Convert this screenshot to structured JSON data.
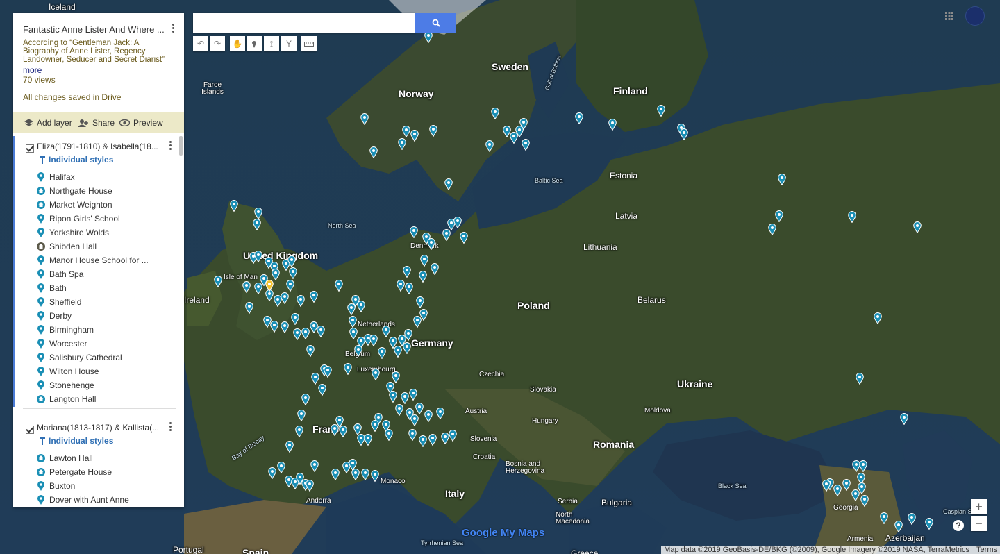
{
  "map": {
    "countries": [
      {
        "id": "iceland",
        "text": "Iceland"
      },
      {
        "id": "sweden",
        "text": "Sweden"
      },
      {
        "id": "finland",
        "text": "Finland"
      },
      {
        "id": "norway",
        "text": "Norway"
      },
      {
        "id": "estonia",
        "text": "Estonia"
      },
      {
        "id": "latvia",
        "text": "Latvia"
      },
      {
        "id": "lithuania",
        "text": "Lithuania"
      },
      {
        "id": "united-kingdom",
        "text": "United Kingdom"
      },
      {
        "id": "ireland",
        "text": "Ireland"
      },
      {
        "id": "denmark",
        "text": "Denmark"
      },
      {
        "id": "netherlands",
        "text": "Netherlands"
      },
      {
        "id": "belgium",
        "text": "Belgium"
      },
      {
        "id": "luxembourg",
        "text": "Luxembourg"
      },
      {
        "id": "germany",
        "text": "Germany"
      },
      {
        "id": "poland",
        "text": "Poland"
      },
      {
        "id": "belarus",
        "text": "Belarus"
      },
      {
        "id": "ukraine",
        "text": "Ukraine"
      },
      {
        "id": "czechia",
        "text": "Czechia"
      },
      {
        "id": "slovakia",
        "text": "Slovakia"
      },
      {
        "id": "austria",
        "text": "Austria"
      },
      {
        "id": "hungary",
        "text": "Hungary"
      },
      {
        "id": "moldova",
        "text": "Moldova"
      },
      {
        "id": "france",
        "text": "France"
      },
      {
        "id": "slovenia",
        "text": "Slovenia"
      },
      {
        "id": "croatia",
        "text": "Croatia"
      },
      {
        "id": "bosnia",
        "text": "Bosnia and Herzegovina"
      },
      {
        "id": "serbia",
        "text": "Serbia"
      },
      {
        "id": "romania",
        "text": "Romania"
      },
      {
        "id": "bulgaria",
        "text": "Bulgaria"
      },
      {
        "id": "north-macedonia",
        "text": "North Macedonia"
      },
      {
        "id": "italy",
        "text": "Italy"
      },
      {
        "id": "monaco",
        "text": "Monaco"
      },
      {
        "id": "andorra",
        "text": "Andorra"
      },
      {
        "id": "portugal",
        "text": "Portugal"
      },
      {
        "id": "spain",
        "text": "Spain"
      },
      {
        "id": "greece",
        "text": "Greece"
      },
      {
        "id": "georgia",
        "text": "Georgia"
      },
      {
        "id": "armenia",
        "text": "Armenia"
      },
      {
        "id": "azerbaijan",
        "text": "Azerbaijan"
      },
      {
        "id": "faroe",
        "text": "Faroe Islands"
      },
      {
        "id": "isle-of-man",
        "text": "Isle of Man"
      }
    ],
    "seas": [
      {
        "id": "north-sea",
        "text": "North Sea"
      },
      {
        "id": "baltic-sea",
        "text": "Baltic Sea"
      },
      {
        "id": "gulf-bothnia",
        "text": "Gulf of Bothnia"
      },
      {
        "id": "bay-biscay",
        "text": "Bay of Biscay"
      },
      {
        "id": "black-sea",
        "text": "Black Sea"
      },
      {
        "id": "caspian-sea",
        "text": "Caspian Sea"
      },
      {
        "id": "tyrrhenian-sea",
        "text": "Tyrrhenian Sea"
      }
    ],
    "pin_color": "#1a8fb5",
    "highlight_pin_color": "#f2c230"
  },
  "panel": {
    "title": "Fantastic Anne Lister And Where ...",
    "description": "According to “Gentleman Jack: A Biography of Anne Lister, Regency Landowner, Seducer and Secret Diarist”",
    "more": "more",
    "views": "70 views",
    "saved": "All changes saved in Drive",
    "actions": {
      "add_layer": "Add layer",
      "share": "Share",
      "preview": "Preview"
    },
    "layers": [
      {
        "name": "Eliza(1791-1810) & Isabella(18...",
        "styles": "Individual styles",
        "items": [
          {
            "label": "Halifax",
            "icon": "pin"
          },
          {
            "label": "Northgate House",
            "icon": "home"
          },
          {
            "label": "Market Weighton",
            "icon": "home"
          },
          {
            "label": "Ripon Girls' School",
            "icon": "pin"
          },
          {
            "label": "Yorkshire Wolds",
            "icon": "pin"
          },
          {
            "label": "Shibden Hall",
            "icon": "home-dark"
          },
          {
            "label": "Manor House School for ...",
            "icon": "pin"
          },
          {
            "label": "Bath Spa",
            "icon": "pin"
          },
          {
            "label": "Bath",
            "icon": "pin"
          },
          {
            "label": "Sheffield",
            "icon": "pin"
          },
          {
            "label": "Derby",
            "icon": "pin"
          },
          {
            "label": "Birmingham",
            "icon": "pin"
          },
          {
            "label": "Worcester",
            "icon": "pin"
          },
          {
            "label": "Salisbury Cathedral",
            "icon": "pin"
          },
          {
            "label": "Wilton House",
            "icon": "pin"
          },
          {
            "label": "Stonehenge",
            "icon": "pin"
          },
          {
            "label": "Langton Hall",
            "icon": "home"
          }
        ]
      },
      {
        "name": "Mariana(1813-1817) & Kallista(...",
        "styles": "Individual styles",
        "items": [
          {
            "label": "Lawton Hall",
            "icon": "home"
          },
          {
            "label": "Petergate House",
            "icon": "home"
          },
          {
            "label": "Buxton",
            "icon": "pin"
          },
          {
            "label": "Dover with Aunt Anne",
            "icon": "pin"
          }
        ]
      }
    ]
  },
  "search": {
    "placeholder": "",
    "value": ""
  },
  "footer": {
    "attribution": "Map data ©2019 GeoBasis-DE/BKG (©2009), Google Imagery ©2019 NASA, TerraMetrics",
    "terms": "Terms"
  },
  "brand": "Google My Maps",
  "zoom": {
    "in": "+",
    "out": "−"
  },
  "help": "?"
}
